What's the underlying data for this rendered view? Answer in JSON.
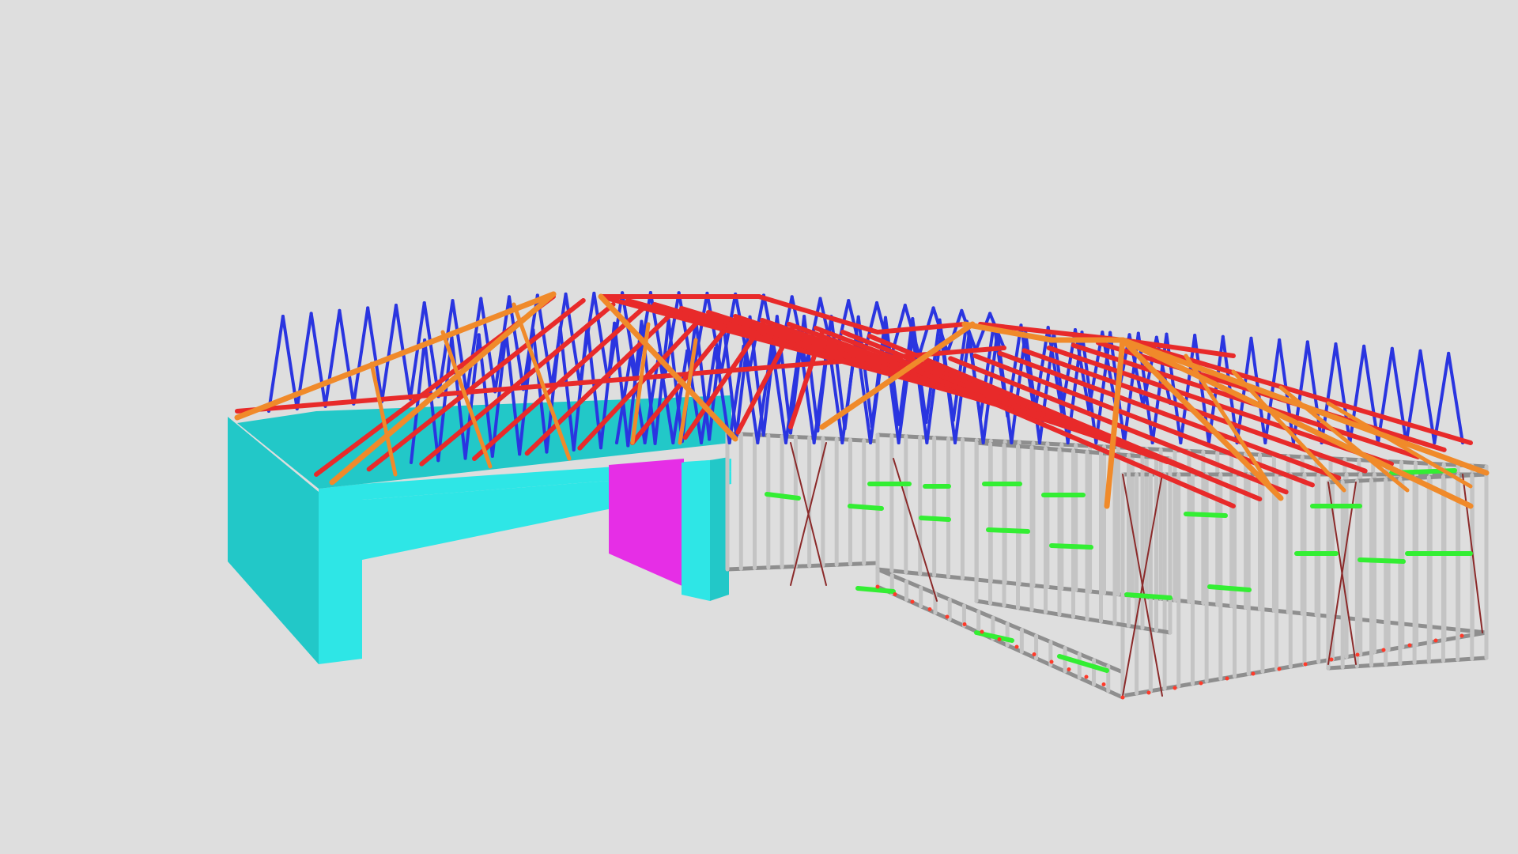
{
  "viewer": {
    "background_color": "#dedede",
    "model_label": "",
    "colors": {
      "masonry_wall": "#2ee6e6",
      "masonry_wall_shade": "#22c8c8",
      "panel": "#e62ee6",
      "wall_frame": "#c4c4c4",
      "wall_frame_dark": "#8e8e8e",
      "brace": "#8b2a2a",
      "nogging": "#33ee33",
      "truss_top_chord": "#e82a2a",
      "truss_web": "#2a35e0",
      "hip_rafter": "#f08a2a",
      "anchor_point": "#ff3a2a"
    }
  }
}
